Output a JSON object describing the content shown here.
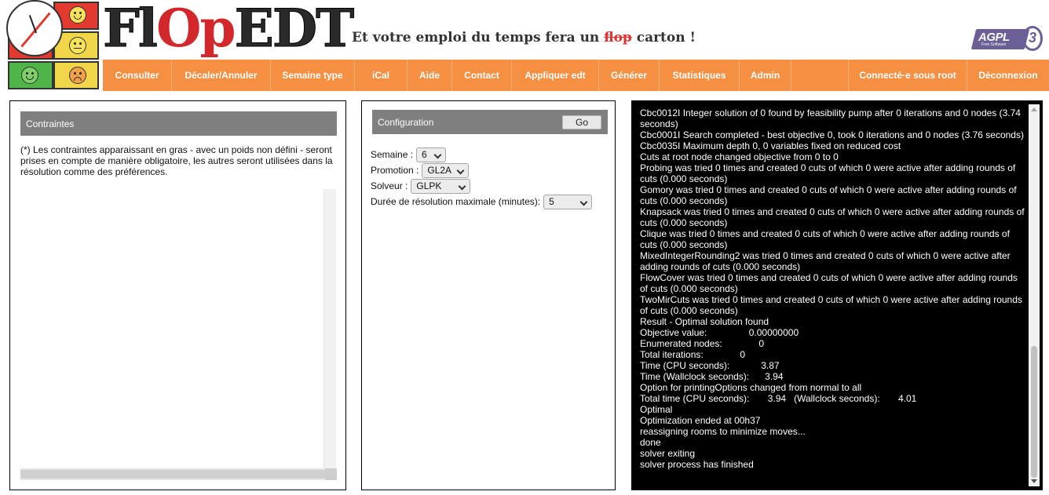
{
  "header": {
    "brand": {
      "part1": "Fl",
      "part2": "Op",
      "part3": "EDT"
    },
    "tagline_before": "Et votre emploi du temps fera un ",
    "tagline_strike": "flop",
    "tagline_after": " carton !",
    "license": {
      "name": "AGPL",
      "version": "3",
      "sub": "Free Software"
    }
  },
  "nav": {
    "items": [
      "Consulter",
      "Décaler/Annuler",
      "Semaine type",
      "iCal",
      "Aide",
      "Contact",
      "Appliquer edt",
      "Générer",
      "Statistiques",
      "Admin"
    ],
    "user_status": "Connecté·e sous root",
    "logout": "Déconnexion",
    "accent": "#f59042"
  },
  "constraints": {
    "title": "Contraintes",
    "note": "(*) Les contraintes apparaissant en gras - avec un poids non défini - seront prises en compte de manière obligatoire, les autres seront utilisées dans la résolution comme des préférences."
  },
  "configuration": {
    "title": "Configuration",
    "go_label": "Go",
    "fields": [
      {
        "label": "Semaine :",
        "value": "6"
      },
      {
        "label": "Promotion :",
        "value": "GL2A"
      },
      {
        "label": "Solveur :",
        "value": "GLPK"
      },
      {
        "label": "Durée de résolution maximale (minutes):",
        "value": "5"
      }
    ]
  },
  "console": {
    "lines": [
      "Cbc0012I Integer solution of 0 found by feasibility pump after 0 iterations and 0 nodes (3.74 seconds)",
      "Cbc0001I Search completed - best objective 0, took 0 iterations and 0 nodes (3.76 seconds)",
      "Cbc0035I Maximum depth 0, 0 variables fixed on reduced cost",
      "Cuts at root node changed objective from 0 to 0",
      "Probing was tried 0 times and created 0 cuts of which 0 were active after adding rounds of cuts (0.000 seconds)",
      "Gomory was tried 0 times and created 0 cuts of which 0 were active after adding rounds of cuts (0.000 seconds)",
      "Knapsack was tried 0 times and created 0 cuts of which 0 were active after adding rounds of cuts (0.000 seconds)",
      "Clique was tried 0 times and created 0 cuts of which 0 were active after adding rounds of cuts (0.000 seconds)",
      "MixedIntegerRounding2 was tried 0 times and created 0 cuts of which 0 were active after adding rounds of cuts (0.000 seconds)",
      "FlowCover was tried 0 times and created 0 cuts of which 0 were active after adding rounds of cuts (0.000 seconds)",
      "TwoMirCuts was tried 0 times and created 0 cuts of which 0 were active after adding rounds of cuts (0.000 seconds)",
      "Result - Optimal solution found",
      "Objective value:                0.00000000",
      "Enumerated nodes:              0",
      "Total iterations:              0",
      "Time (CPU seconds):            3.87",
      "Time (Wallclock seconds):      3.94",
      "Option for printingOptions changed from normal to all",
      "Total time (CPU seconds):       3.94   (Wallclock seconds):       4.01",
      "Optimal",
      "Optimization ended at 00h37",
      "reassigning rooms to minimize moves...",
      "done",
      "solver exiting",
      "solver process has finished"
    ]
  }
}
